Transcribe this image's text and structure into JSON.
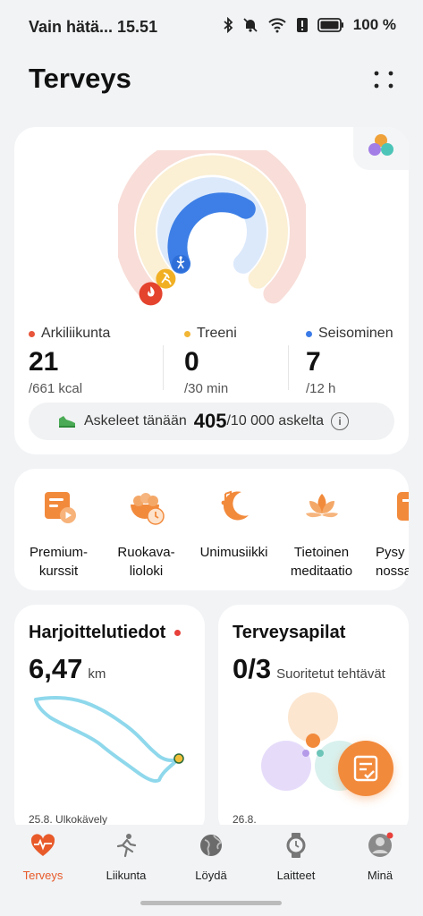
{
  "status_bar": {
    "left_text": "Vain hätä... 15.51",
    "battery": "100 %"
  },
  "header": {
    "title": "Terveys"
  },
  "activity": {
    "metrics": [
      {
        "label": "Arkiliikunta",
        "value": "21",
        "goal": "/661 kcal",
        "color": "#e8553a",
        "progress": 0.03
      },
      {
        "label": "Treeni",
        "value": "0",
        "goal": "/30 min",
        "color": "#f2b636",
        "progress": 0.0
      },
      {
        "label": "Seisominen",
        "value": "7",
        "goal": "/12 h",
        "color": "#3b7be8",
        "progress": 0.58
      }
    ],
    "steps": {
      "label": "Askeleet tänään",
      "value": "405",
      "goal": "/10 000 askelta"
    }
  },
  "services": [
    {
      "label_line1": "Premium-",
      "label_line2": "kurssit",
      "icon": "course-play-icon"
    },
    {
      "label_line1": "Ruokava-",
      "label_line2": "lioloki",
      "icon": "food-log-icon"
    },
    {
      "label_line1": "Unimusiikki",
      "label_line2": "",
      "icon": "sleep-music-icon"
    },
    {
      "label_line1": "Tietoinen",
      "label_line2": "meditaatio",
      "icon": "meditation-lotus-icon"
    },
    {
      "label_line1": "Pysy",
      "label_line2": "nossa",
      "icon": "partial-service-icon"
    }
  ],
  "training": {
    "title": "Harjoittelutiedot",
    "value": "6,47",
    "unit": "km",
    "footer": "25.8. Ulkokävely"
  },
  "clover": {
    "title": "Terveysapilat",
    "value": "0/3",
    "subtitle": "Suoritetut tehtävät",
    "footer": "26.8."
  },
  "tabs": [
    {
      "label": "Terveys",
      "active": true,
      "icon": "heart-pulse-icon"
    },
    {
      "label": "Liikunta",
      "active": false,
      "icon": "running-icon"
    },
    {
      "label": "Löydä",
      "active": false,
      "icon": "globe-icon"
    },
    {
      "label": "Laitteet",
      "active": false,
      "icon": "watch-icon"
    },
    {
      "label": "Minä",
      "active": false,
      "icon": "user-avatar-icon"
    }
  ]
}
